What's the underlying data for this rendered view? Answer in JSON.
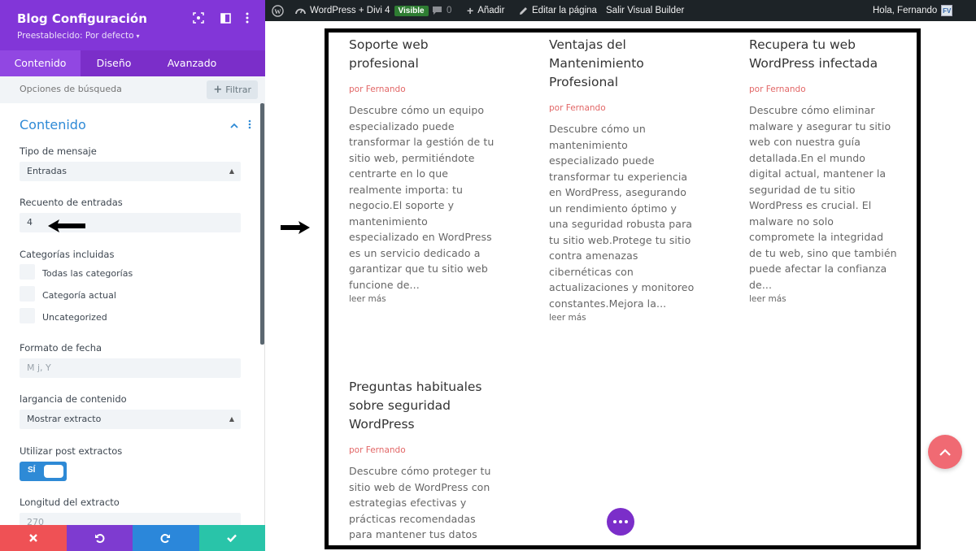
{
  "panel": {
    "title": "Blog Configuración",
    "preset": "Preestablecido: Por defecto",
    "tabs": [
      {
        "label": "Contenido",
        "active": true
      },
      {
        "label": "Diseño",
        "active": false
      },
      {
        "label": "Avanzado",
        "active": false
      }
    ],
    "search_placeholder": "Opciones de búsqueda",
    "filter_label": "Filtrar",
    "section_title": "Contenido",
    "fields": {
      "post_type_label": "Tipo de mensaje",
      "post_type_value": "Entradas",
      "post_count_label": "Recuento de entradas",
      "post_count_value": "4",
      "categories_label": "Categorías incluidas",
      "categories": [
        "Todas las categorías",
        "Categoría actual",
        "Uncategorized"
      ],
      "date_format_label": "Formato de fecha",
      "date_format_placeholder": "M j, Y",
      "content_length_label": "largancia de contenido",
      "content_length_value": "Mostrar extracto",
      "use_excerpts_label": "Utilizar post extractos",
      "use_excerpts_toggle": "SÍ",
      "use_excerpts_on": true,
      "excerpt_length_label": "Longitud del extracto",
      "excerpt_length_placeholder": "270"
    },
    "footer_colors": {
      "discard": "#ef5155",
      "undo": "#7e3bd0",
      "redo": "#2b87da",
      "save": "#29c4a9"
    }
  },
  "adminbar": {
    "site_name": "WordPress + Divi 4",
    "visibility_badge": "Visible",
    "comments_count": "0",
    "add_new": "Añadir",
    "edit_page": "Editar la página",
    "exit_builder": "Salir Visual Builder",
    "greeting": "Hola, Fernando"
  },
  "posts": [
    {
      "title": "Soporte web profesional",
      "author": "por Fernando",
      "excerpt": "Descubre cómo un equipo especializado puede transformar la gestión de tu sitio web, permitiéndote centrarte en lo que realmente importa: tu negocio.El soporte y mantenimiento especializado en WordPress es un servicio dedicado a garantizar que tu sitio web funcione de...",
      "more": "leer más"
    },
    {
      "title": "Ventajas del Mantenimiento Profesional",
      "author": "por Fernando",
      "excerpt": "Descubre cómo un mantenimiento especializado puede transformar tu experiencia en WordPress, asegurando un rendimiento óptimo y una seguridad robusta para tu sitio web.Protege tu sitio contra amenazas cibernéticas con actualizaciones y monitoreo constantes.Mejora la...",
      "more": "leer más"
    },
    {
      "title": "Recupera tu web WordPress infectada",
      "author": "por Fernando",
      "excerpt": "Descubre cómo eliminar malware y asegurar tu sitio web con nuestra guía detallada.En el mundo digital actual, mantener la seguridad de tu sitio WordPress es crucial. El malware no solo compromete la integridad de tu web, sino que también puede afectar la confianza de...",
      "more": "leer más"
    },
    {
      "title": "Preguntas habituales sobre seguridad WordPress",
      "author": "por Fernando",
      "excerpt": "Descubre cómo proteger tu sitio web de WordPress con estrategias efectivas y prácticas recomendadas para mantener tus datos seguros.",
      "more": ""
    }
  ]
}
